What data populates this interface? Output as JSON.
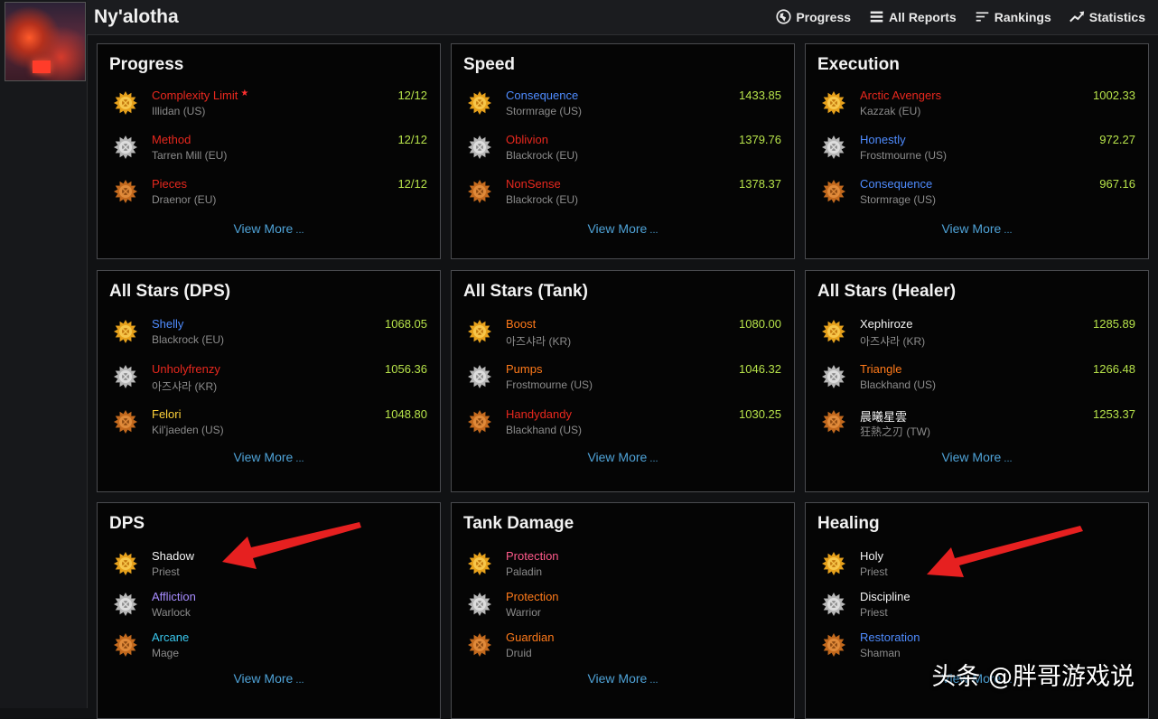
{
  "zone": {
    "title": "Ny'alotha"
  },
  "nav": [
    {
      "label": "Progress",
      "icon": "globe-icon"
    },
    {
      "label": "All Reports",
      "icon": "list-icon"
    },
    {
      "label": "Rankings",
      "icon": "rankings-icon"
    },
    {
      "label": "Statistics",
      "icon": "trend-icon"
    }
  ],
  "colors": {
    "red": "#e8281e",
    "blue": "#4f8cff",
    "orange": "#ff7a1a",
    "white": "#f4f4f4",
    "purple": "#a78cff",
    "cyan": "#3ac8ee",
    "yellow": "#ffd23a",
    "value": "#b7e34a",
    "link": "#4fa3d8",
    "arrow": "#e62020"
  },
  "view_more": "View More",
  "watermark": "头条 @胖哥游戏说",
  "panels": [
    {
      "title": "Progress",
      "rows": [
        {
          "name": "Complexity Limit",
          "sub": "Illidan (US)",
          "value": "12/12",
          "color": "red",
          "medal": "gold",
          "starred": true
        },
        {
          "name": "Method",
          "sub": "Tarren Mill (EU)",
          "value": "12/12",
          "color": "red",
          "medal": "silver"
        },
        {
          "name": "Pieces",
          "sub": "Draenor (EU)",
          "value": "12/12",
          "color": "red",
          "medal": "bronze"
        }
      ]
    },
    {
      "title": "Speed",
      "rows": [
        {
          "name": "Consequence",
          "sub": "Stormrage (US)",
          "value": "1433.85",
          "color": "blue",
          "medal": "gold"
        },
        {
          "name": "Oblivion",
          "sub": "Blackrock (EU)",
          "value": "1379.76",
          "color": "red",
          "medal": "silver"
        },
        {
          "name": "NonSense",
          "sub": "Blackrock (EU)",
          "value": "1378.37",
          "color": "red",
          "medal": "bronze"
        }
      ]
    },
    {
      "title": "Execution",
      "rows": [
        {
          "name": "Arctic Avengers",
          "sub": "Kazzak (EU)",
          "value": "1002.33",
          "color": "red",
          "medal": "gold"
        },
        {
          "name": "Honestly",
          "sub": "Frostmourne (US)",
          "value": "972.27",
          "color": "blue",
          "medal": "silver"
        },
        {
          "name": "Consequence",
          "sub": "Stormrage (US)",
          "value": "967.16",
          "color": "blue",
          "medal": "bronze"
        }
      ]
    },
    {
      "title": "All Stars (DPS)",
      "rows": [
        {
          "name": "Shelly",
          "sub": "Blackrock (EU)",
          "value": "1068.05",
          "color": "blue",
          "medal": "gold"
        },
        {
          "name": "Unholyfrenzy",
          "sub": "아즈샤라 (KR)",
          "value": "1056.36",
          "color": "red",
          "medal": "silver"
        },
        {
          "name": "Felori",
          "sub": "Kil'jaeden (US)",
          "value": "1048.80",
          "color": "yellow",
          "medal": "bronze"
        }
      ]
    },
    {
      "title": "All Stars (Tank)",
      "rows": [
        {
          "name": "Boost",
          "sub": "아즈샤라 (KR)",
          "value": "1080.00",
          "color": "orange",
          "medal": "gold"
        },
        {
          "name": "Pumps",
          "sub": "Frostmourne (US)",
          "value": "1046.32",
          "color": "orange",
          "medal": "silver"
        },
        {
          "name": "Handydandy",
          "sub": "Blackhand (US)",
          "value": "1030.25",
          "color": "red",
          "medal": "bronze"
        }
      ]
    },
    {
      "title": "All Stars (Healer)",
      "rows": [
        {
          "name": "Xephiroze",
          "sub": "아즈샤라 (KR)",
          "value": "1285.89",
          "color": "white",
          "medal": "gold"
        },
        {
          "name": "Triangle",
          "sub": "Blackhand (US)",
          "value": "1266.48",
          "color": "orange",
          "medal": "silver"
        },
        {
          "name": "晨曦星雲",
          "sub": "狂熱之刃 (TW)",
          "value": "1253.37",
          "color": "white",
          "medal": "bronze"
        }
      ]
    },
    {
      "title": "DPS",
      "rows": [
        {
          "name": "Shadow",
          "sub": "Priest",
          "value": "",
          "color": "white",
          "medal": "gold"
        },
        {
          "name": "Affliction",
          "sub": "Warlock",
          "value": "",
          "color": "purple",
          "medal": "silver"
        },
        {
          "name": "Arcane",
          "sub": "Mage",
          "value": "",
          "color": "cyan",
          "medal": "bronze"
        }
      ]
    },
    {
      "title": "Tank Damage",
      "rows": [
        {
          "name": "Protection",
          "sub": "Paladin",
          "value": "",
          "color": "pink",
          "medal": "gold"
        },
        {
          "name": "Protection",
          "sub": "Warrior",
          "value": "",
          "color": "orange",
          "medal": "silver"
        },
        {
          "name": "Guardian",
          "sub": "Druid",
          "value": "",
          "color": "orange",
          "medal": "bronze"
        }
      ]
    },
    {
      "title": "Healing",
      "rows": [
        {
          "name": "Holy",
          "sub": "Priest",
          "value": "",
          "color": "white",
          "medal": "gold"
        },
        {
          "name": "Discipline",
          "sub": "Priest",
          "value": "",
          "color": "white",
          "medal": "silver"
        },
        {
          "name": "Restoration",
          "sub": "Shaman",
          "value": "",
          "color": "blue",
          "medal": "bronze"
        }
      ]
    }
  ]
}
